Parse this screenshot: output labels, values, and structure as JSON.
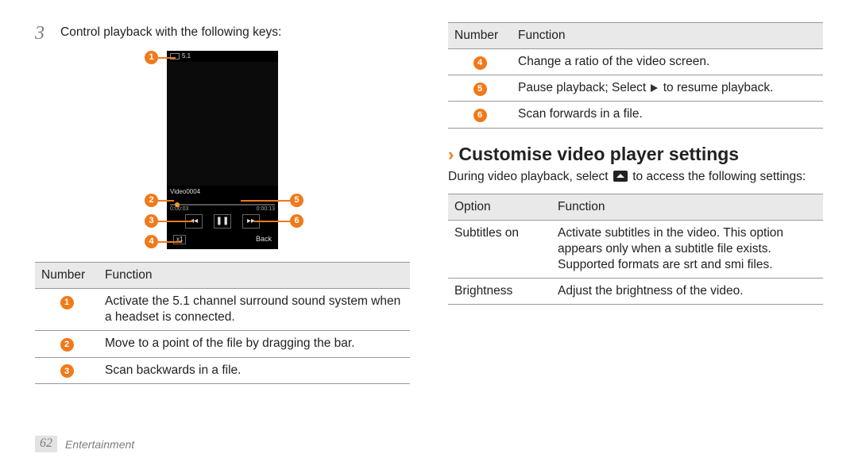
{
  "step": {
    "number": "3",
    "text": "Control playback with the following keys:"
  },
  "phone": {
    "status_51": "5.1",
    "video_title": "Video0004",
    "time_start": "0:00:03",
    "time_end": "0:00:13",
    "btn_rew": "◂◂",
    "btn_pause": "❚❚",
    "btn_ff": "▸▸",
    "ratio": "x1",
    "back": "Back"
  },
  "badges": {
    "b1": "1",
    "b2": "2",
    "b3": "3",
    "b4": "4",
    "b5": "5",
    "b6": "6"
  },
  "table_left": {
    "h1": "Number",
    "h2": "Function",
    "rows": [
      {
        "n": "1",
        "f": "Activate the 5.1 channel surround sound system when a headset is connected."
      },
      {
        "n": "2",
        "f": "Move to a point of the file by dragging the bar."
      },
      {
        "n": "3",
        "f": "Scan backwards in a file."
      }
    ]
  },
  "table_right1": {
    "h1": "Number",
    "h2": "Function",
    "rows": [
      {
        "n": "4",
        "f": "Change a ratio of the video screen."
      },
      {
        "n": "5",
        "f_pre": "Pause playback; Select ",
        "f_post": " to resume playback."
      },
      {
        "n": "6",
        "f": "Scan forwards in a file."
      }
    ]
  },
  "heading2": "Customise video player settings",
  "settings_line_pre": "During video playback, select ",
  "settings_line_post": " to access the following settings:",
  "table_right2": {
    "h1": "Option",
    "h2": "Function",
    "rows": [
      {
        "o": "Subtitles on",
        "f": "Activate subtitles in the video. This option appears only when a subtitle file exists. Supported formats are srt and smi files."
      },
      {
        "o": "Brightness",
        "f": "Adjust the brightness of the video."
      }
    ]
  },
  "footer": {
    "page": "62",
    "section": "Entertainment"
  }
}
